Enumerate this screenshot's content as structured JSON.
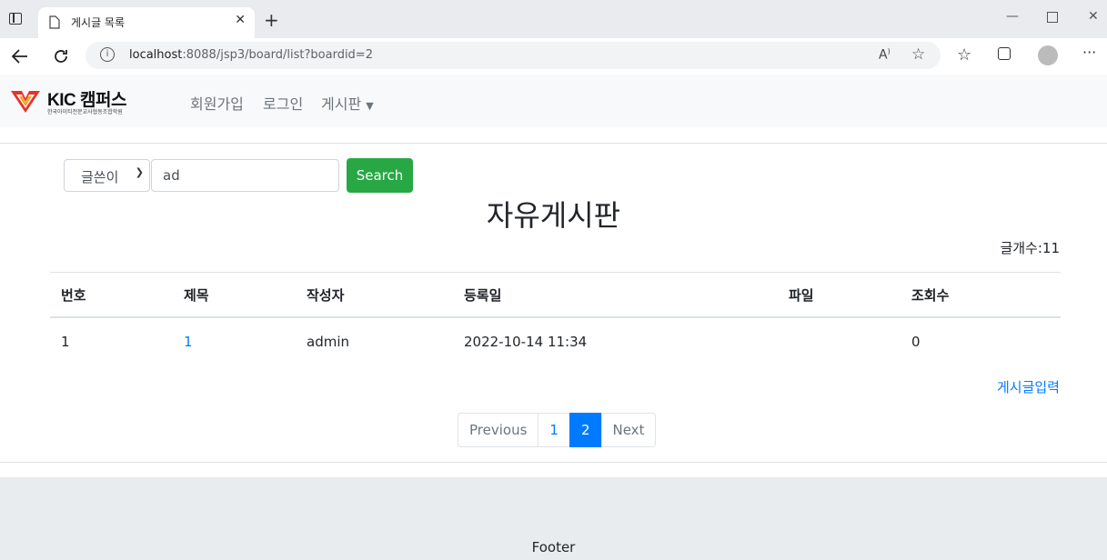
{
  "browser": {
    "tab_title": "게시글 목록",
    "url_host": "localhost",
    "url_rest": ":8088/jsp3/board/list?boardid=2"
  },
  "navbar": {
    "brand": "KIC 캠퍼스",
    "brand_sub": "한국아이티전문교사협동조합학원",
    "links": [
      "회원가입",
      "로그인",
      "게시판"
    ]
  },
  "search": {
    "select_value": "글쓴이",
    "input_value": "ad",
    "button_label": "Search"
  },
  "board": {
    "title": "자유게시판",
    "count": "글개수:11",
    "columns": [
      "번호",
      "제목",
      "작성자",
      "등록일",
      "파일",
      "조회수"
    ],
    "rows": [
      {
        "no": "1",
        "subject": "1",
        "writer": "admin",
        "date": "2022-10-14 11:34",
        "file": "",
        "views": "0"
      }
    ],
    "write_link": "게시글입력"
  },
  "pagination": {
    "previous": "Previous",
    "pages": [
      "1",
      "2"
    ],
    "active": "2",
    "next": "Next"
  },
  "footer": {
    "text": "Footer"
  },
  "colors": {
    "accent": "#007bff",
    "success": "#28a745"
  }
}
